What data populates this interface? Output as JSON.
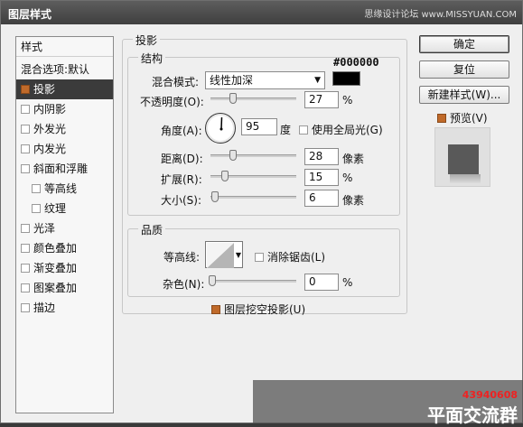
{
  "window": {
    "title": "图层样式",
    "watermark": "思缘设计论坛 www.MISSYUAN.COM"
  },
  "sidebar": {
    "header": "样式",
    "blend_options": "混合选项:默认",
    "items": [
      {
        "label": "投影",
        "checked": true,
        "selected": true
      },
      {
        "label": "内阴影",
        "checked": false
      },
      {
        "label": "外发光",
        "checked": false
      },
      {
        "label": "内发光",
        "checked": false
      },
      {
        "label": "斜面和浮雕",
        "checked": false
      },
      {
        "label": "等高线",
        "checked": false,
        "indent": true
      },
      {
        "label": "纹理",
        "checked": false,
        "indent": true
      },
      {
        "label": "光泽",
        "checked": false
      },
      {
        "label": "颜色叠加",
        "checked": false
      },
      {
        "label": "渐变叠加",
        "checked": false
      },
      {
        "label": "图案叠加",
        "checked": false
      },
      {
        "label": "描边",
        "checked": false
      }
    ]
  },
  "drop_shadow": {
    "legend": "投影",
    "structure": {
      "legend": "结构",
      "color_hex_label": "#000000",
      "blend_mode_label": "混合模式:",
      "blend_mode_value": "线性加深",
      "opacity_label": "不透明度(O):",
      "opacity_value": "27",
      "opacity_unit": "%",
      "angle_label": "角度(A):",
      "angle_value": "95",
      "angle_unit": "度",
      "global_light_label": "使用全局光(G)",
      "global_light_checked": false,
      "distance_label": "距离(D):",
      "distance_value": "28",
      "distance_unit": "像素",
      "spread_label": "扩展(R):",
      "spread_value": "15",
      "spread_unit": "%",
      "size_label": "大小(S):",
      "size_value": "6",
      "size_unit": "像素"
    },
    "quality": {
      "legend": "品质",
      "contour_label": "等高线:",
      "antialias_label": "消除锯齿(L)",
      "antialias_checked": false,
      "noise_label": "杂色(N):",
      "noise_value": "0",
      "noise_unit": "%"
    },
    "knockout_label": "图层挖空投影(U)",
    "knockout_checked": true
  },
  "buttons": {
    "ok": "确定",
    "reset": "复位",
    "new_style": "新建样式(W)...",
    "preview_label": "预览(V)",
    "preview_checked": true
  },
  "overlay": {
    "number": "43940608",
    "text": "平面交流群"
  },
  "colors": {
    "shadow_color": "#000000",
    "accent_checkbox": "#c06a2a",
    "selected_row": "#3b3b3b"
  }
}
